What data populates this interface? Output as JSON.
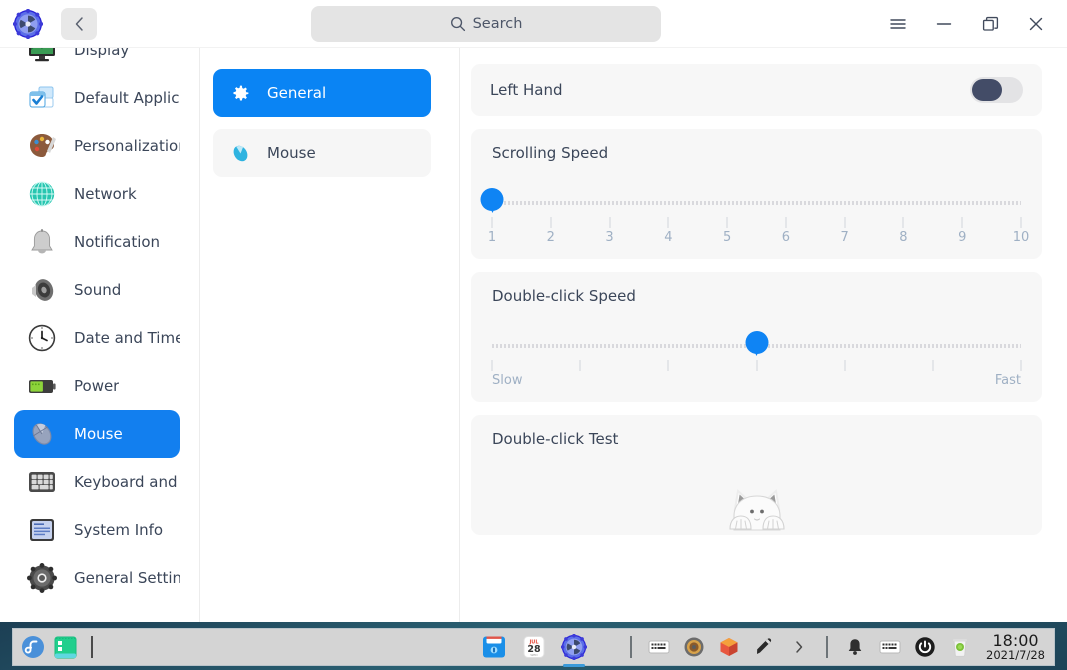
{
  "titlebar": {
    "app_icon": "settings-gear-logo",
    "back_label": "‹",
    "search_placeholder": "Search",
    "search_value": "",
    "search_icon": "search-icon",
    "menu_icon": "hamburger-menu-icon",
    "minimize_icon": "minimize-icon",
    "maximize_icon": "restore-window-icon",
    "close_icon": "close-icon"
  },
  "sidebar": {
    "items": [
      {
        "label": "Display",
        "icon": "display-monitor-icon",
        "selected": false
      },
      {
        "label": "Default Applic...",
        "icon": "default-applications-icon",
        "selected": false
      },
      {
        "label": "Personalization",
        "icon": "personalization-palette-icon",
        "selected": false
      },
      {
        "label": "Network",
        "icon": "network-globe-icon",
        "selected": false
      },
      {
        "label": "Notification",
        "icon": "notification-bell-icon",
        "selected": false
      },
      {
        "label": "Sound",
        "icon": "sound-speaker-icon",
        "selected": false
      },
      {
        "label": "Date and Time",
        "icon": "clock-icon",
        "selected": false
      },
      {
        "label": "Power",
        "icon": "battery-power-icon",
        "selected": false
      },
      {
        "label": "Mouse",
        "icon": "mouse-icon",
        "selected": true
      },
      {
        "label": "Keyboard and ...",
        "icon": "keyboard-icon",
        "selected": false
      },
      {
        "label": "System Info",
        "icon": "system-info-icon",
        "selected": false
      },
      {
        "label": "General Settin...",
        "icon": "general-settings-gear-icon",
        "selected": false
      }
    ]
  },
  "tabs": {
    "items": [
      {
        "label": "General",
        "icon": "gear-icon",
        "active": true
      },
      {
        "label": "Mouse",
        "icon": "mouse-icon",
        "active": false
      }
    ]
  },
  "main": {
    "left_hand": {
      "label": "Left Hand",
      "enabled": false
    },
    "scrolling_speed": {
      "label": "Scrolling Speed",
      "value": 1,
      "min": 1,
      "max": 10,
      "ticks": [
        "1",
        "2",
        "3",
        "4",
        "5",
        "6",
        "7",
        "8",
        "9",
        "10"
      ]
    },
    "double_click_speed": {
      "label": "Double-click Speed",
      "value": 4,
      "min": 1,
      "max": 7,
      "tick_count": 7,
      "min_label": "Slow",
      "max_label": "Fast"
    },
    "double_click_test": {
      "label": "Double-click Test",
      "illustration": "peeking-cat-illustration"
    }
  },
  "taskbar": {
    "left_icons": [
      {
        "name": "fedora-launcher-icon",
        "label": ""
      },
      {
        "name": "terminal-icon",
        "label": ""
      }
    ],
    "center_icons": [
      {
        "name": "file-manager-icon",
        "label": "",
        "active": false
      },
      {
        "name": "calendar-icon",
        "label": "",
        "active": false
      },
      {
        "name": "settings-icon",
        "label": "",
        "active": true
      }
    ],
    "calendar": {
      "month": "JUL",
      "day": "28"
    },
    "tray_icons": [
      {
        "name": "input-method-keyboard-icon"
      },
      {
        "name": "disk-tray-icon"
      },
      {
        "name": "package-updates-icon"
      },
      {
        "name": "pen-tool-icon"
      },
      {
        "name": "tray-expand-chevron-icon"
      }
    ],
    "status_icons": [
      {
        "name": "notification-bell-icon"
      },
      {
        "name": "keyboard-layout-icon"
      },
      {
        "name": "power-icon"
      },
      {
        "name": "trash-icon"
      }
    ],
    "clock": {
      "time": "18:00",
      "date": "2021/7/28"
    }
  },
  "colors": {
    "accent": "#0f84f4",
    "sidebar_selected": "#127fef",
    "card_bg": "#f7f7f7",
    "text": "#3b4659",
    "tick_text": "#9fb0c4",
    "toggle_knob": "#434c67"
  }
}
